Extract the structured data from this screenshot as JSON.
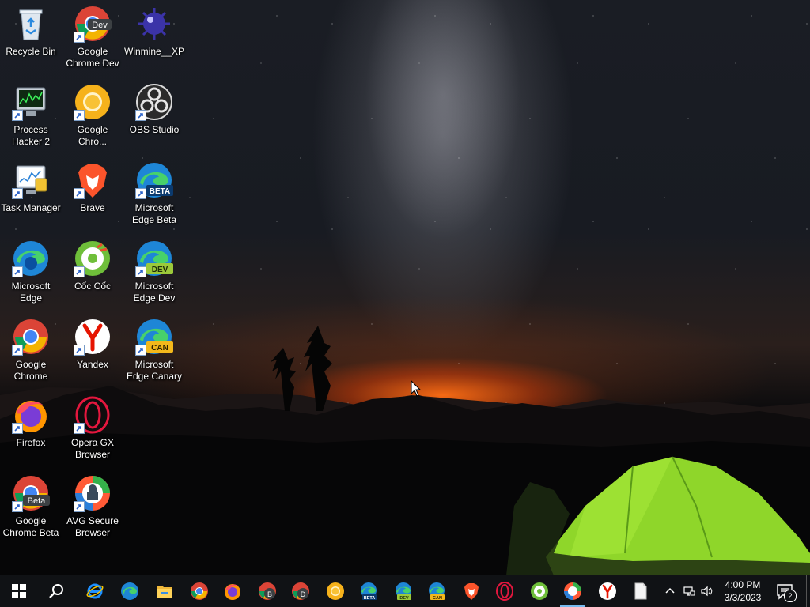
{
  "desktop": {
    "icons": [
      {
        "label": "Recycle Bin",
        "icon": "recycle-bin-icon"
      },
      {
        "label": "Google Chrome Dev",
        "icon": "chrome-dev-icon",
        "badge": "Dev"
      },
      {
        "label": "Winmine__XP",
        "icon": "winmine-icon"
      },
      {
        "label": "Process Hacker 2",
        "icon": "process-hacker-icon"
      },
      {
        "label": "Google Chro...",
        "icon": "chrome-canary-icon"
      },
      {
        "label": "OBS Studio",
        "icon": "obs-icon"
      },
      {
        "label": "Task Manager",
        "icon": "task-manager-icon"
      },
      {
        "label": "Brave",
        "icon": "brave-icon"
      },
      {
        "label": "Microsoft Edge Beta",
        "icon": "edge-beta-icon",
        "badge": "BETA"
      },
      {
        "label": "Microsoft Edge",
        "icon": "edge-icon"
      },
      {
        "label": "Cốc Cốc",
        "icon": "coccoc-icon"
      },
      {
        "label": "Microsoft Edge Dev",
        "icon": "edge-dev-icon",
        "badge": "DEV"
      },
      {
        "label": "Google Chrome",
        "icon": "chrome-icon"
      },
      {
        "label": "Yandex",
        "icon": "yandex-icon"
      },
      {
        "label": "Microsoft Edge Canary",
        "icon": "edge-canary-icon",
        "badge": "CAN"
      },
      {
        "label": "Firefox",
        "icon": "firefox-icon"
      },
      {
        "label": "Opera GX Browser",
        "icon": "opera-gx-icon"
      },
      {
        "label": "Google Chrome Beta",
        "icon": "chrome-beta-icon",
        "badge": "Beta"
      },
      {
        "label": "AVG Secure Browser",
        "icon": "avg-browser-icon"
      }
    ]
  },
  "taskbar": {
    "pinned": [
      {
        "icon": "start-icon"
      },
      {
        "icon": "search-icon"
      },
      {
        "icon": "internet-explorer-icon"
      },
      {
        "icon": "edge-icon"
      },
      {
        "icon": "file-explorer-icon"
      },
      {
        "icon": "chrome-icon"
      },
      {
        "icon": "firefox-icon"
      },
      {
        "icon": "chrome-beta-icon",
        "badge": "B"
      },
      {
        "icon": "chrome-dev-icon",
        "badge": "D"
      },
      {
        "icon": "chrome-canary-icon"
      },
      {
        "icon": "edge-beta-icon",
        "badge": "BETA"
      },
      {
        "icon": "edge-dev-icon",
        "badge": "DEV"
      },
      {
        "icon": "edge-canary-icon",
        "badge": "CAN"
      },
      {
        "icon": "brave-icon"
      },
      {
        "icon": "opera-icon"
      },
      {
        "icon": "coccoc-icon"
      },
      {
        "icon": "avg-browser-icon"
      },
      {
        "icon": "yandex-icon"
      },
      {
        "icon": "notepad-icon"
      }
    ],
    "tray": {
      "icons": [
        "chevron-up-icon",
        "network-icon",
        "volume-icon"
      ],
      "time": "4:00 PM",
      "date": "3/3/2023",
      "notification_count": "2"
    }
  },
  "colors": {
    "taskbar": "#101215",
    "accent": "#76b9ed",
    "tent": "#8fd62a"
  }
}
